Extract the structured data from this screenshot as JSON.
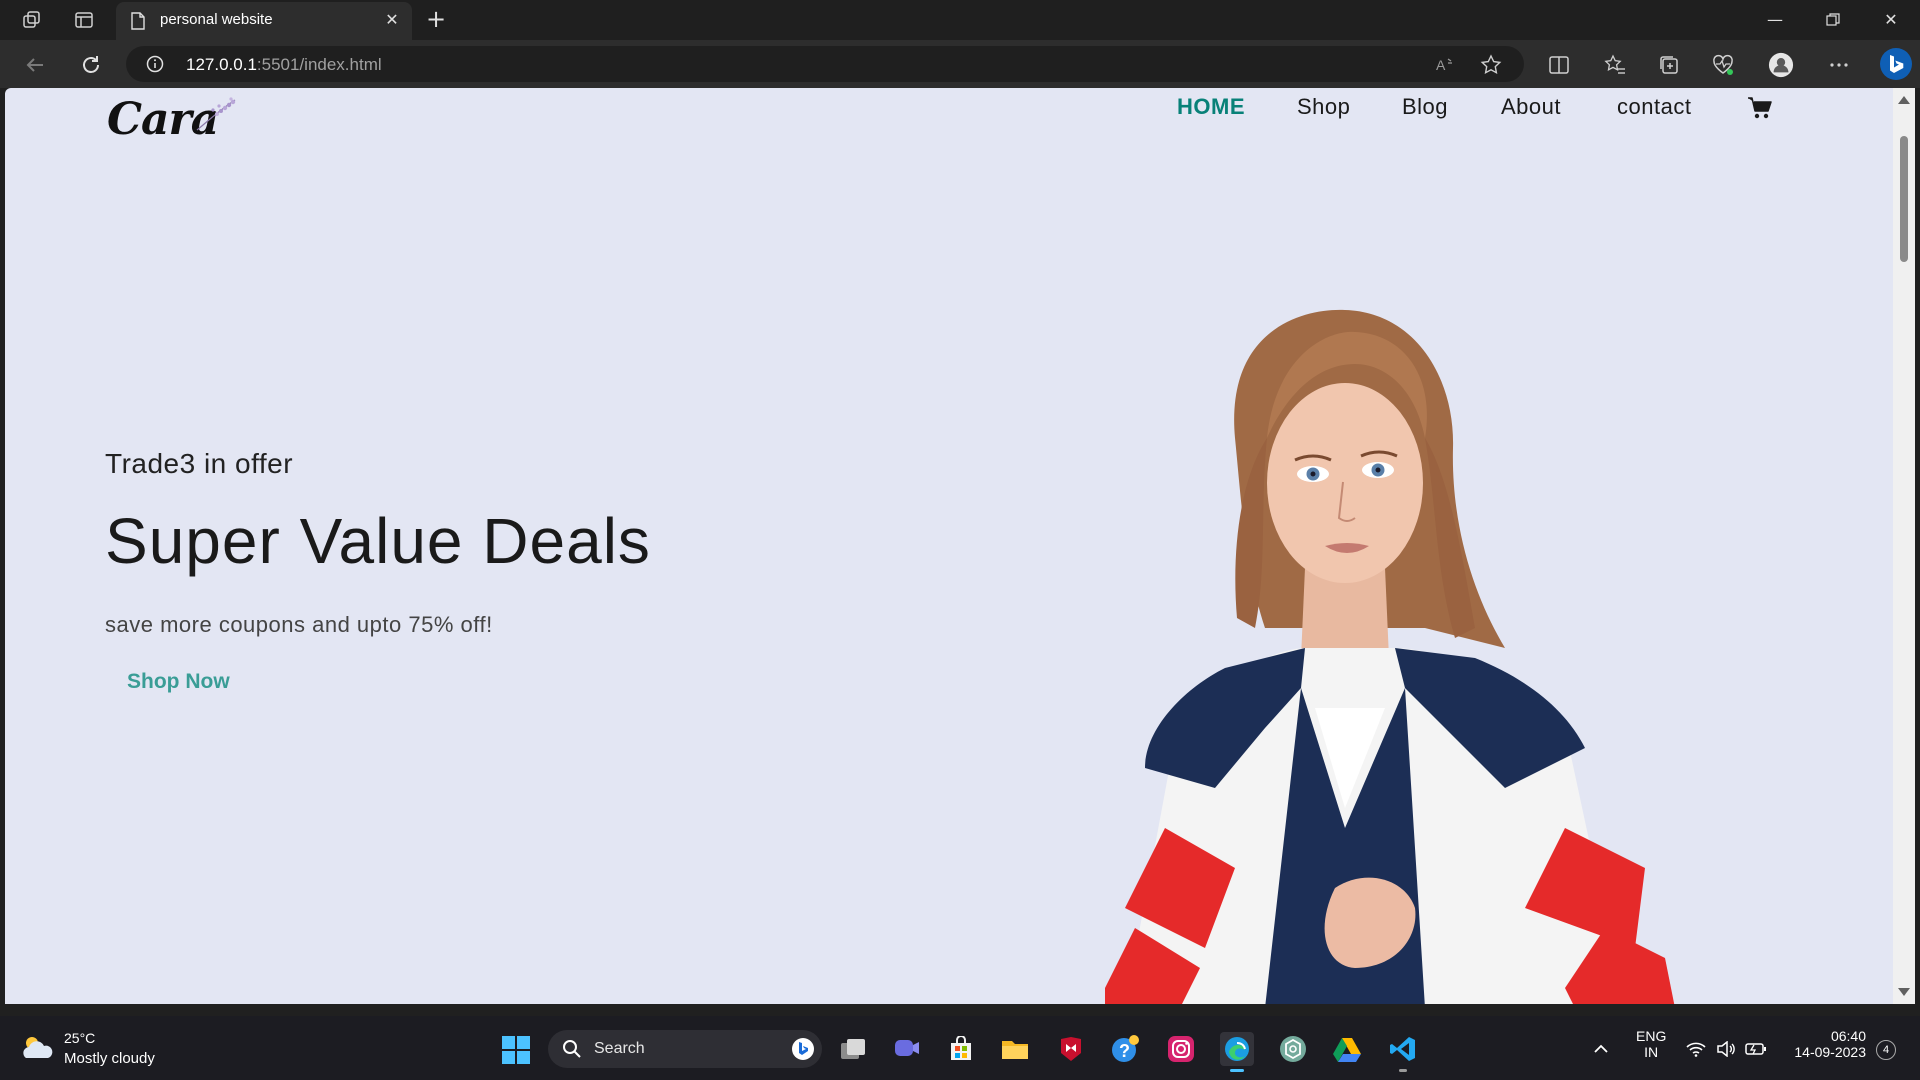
{
  "browser": {
    "tab_title": "personal website",
    "url_host": "127.0.0.1",
    "url_rest": ":5501/index.html"
  },
  "site": {
    "logo_text": "Cara",
    "nav": [
      {
        "label": "HOME",
        "active": true
      },
      {
        "label": "Shop",
        "active": false
      },
      {
        "label": "Blog",
        "active": false
      },
      {
        "label": "About",
        "active": false
      },
      {
        "label": "contact",
        "active": false
      }
    ],
    "hero": {
      "subtitle": "Trade3 in offer",
      "title": "Super Value Deals",
      "text": "save more coupons and upto 75% off!",
      "button": "Shop Now"
    },
    "colors": {
      "accent": "#088178",
      "background": "#e3e6f3",
      "button_text": "#3a9d96"
    }
  },
  "taskbar": {
    "weather_temp": "25°C",
    "weather_desc": "Mostly cloudy",
    "search_placeholder": "Search",
    "lang_top": "ENG",
    "lang_bottom": "IN",
    "time": "06:40",
    "date": "14-09-2023",
    "notification_count": "4"
  }
}
